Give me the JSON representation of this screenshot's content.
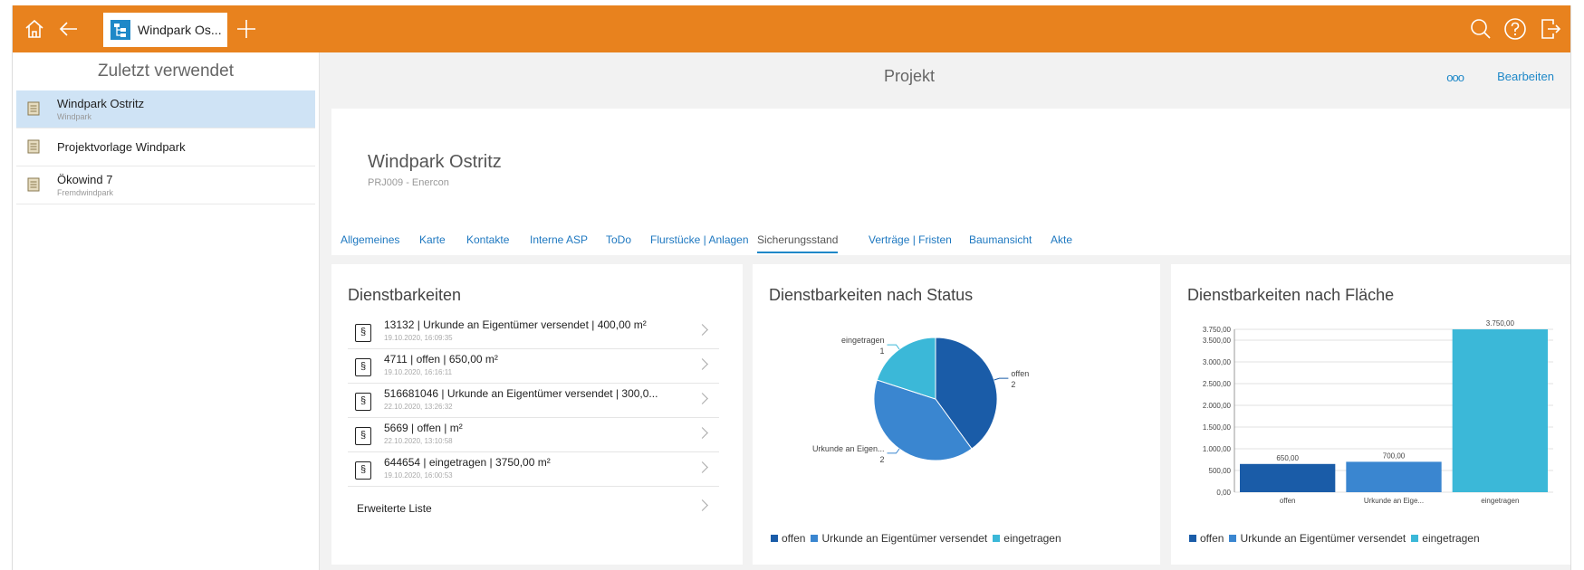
{
  "topbar": {
    "tab_label": "Windpark Os...",
    "icons": [
      "home-icon",
      "back-arrow-icon",
      "plus-icon",
      "search-icon",
      "help-icon",
      "logout-icon"
    ],
    "color": "#e8821e"
  },
  "sidebar": {
    "title": "Zuletzt verwendet",
    "items": [
      {
        "name": "Windpark Ostritz",
        "sub": "Windpark"
      },
      {
        "name": "Projektvorlage Windpark",
        "sub": ""
      },
      {
        "name": "Ökowind 7",
        "sub": "Fremdwindpark"
      }
    ]
  },
  "header": {
    "title": "Projekt",
    "dots": "ooo",
    "edit": "Bearbeiten"
  },
  "project": {
    "name": "Windpark Ostritz",
    "sub": "PRJ009 - Enercon",
    "tabs": [
      "Allgemeines",
      "Karte",
      "Kontakte",
      "Interne ASP",
      "ToDo",
      "Flurstücke | Anlagen",
      "Sicherungsstand",
      "Verträge | Fristen",
      "Baumansicht",
      "Akte"
    ],
    "active_tab": "Sicherungsstand"
  },
  "list_panel": {
    "title": "Dienstbarkeiten",
    "items": [
      {
        "title": "13132 | Urkunde an Eigentümer versendet | 400,00 m²",
        "date": "19.10.2020, 16:09:35"
      },
      {
        "title": "4711 | offen | 650,00 m²",
        "date": "19.10.2020, 16:16:11"
      },
      {
        "title": "516681046 | Urkunde an Eigentümer versendet | 300,0...",
        "date": "22.10.2020, 13:26:32"
      },
      {
        "title": "5669 | offen | m²",
        "date": "22.10.2020, 13:10:58"
      },
      {
        "title": "644654 | eingetragen | 3750,00 m²",
        "date": "19.10.2020, 16:00:53"
      }
    ],
    "more": "Erweiterte Liste",
    "doc_symbol": "§"
  },
  "colors": {
    "offen": "#1a5ca8",
    "urkunde": "#3a86d0",
    "eingetragen": "#3bb8d8"
  },
  "chart_data": [
    {
      "type": "pie",
      "title": "Dienstbarkeiten nach Status",
      "categories": [
        "offen",
        "Urkunde an Eigentümer versendet",
        "eingetragen"
      ],
      "labels": [
        "offen",
        "Urkunde an Eigen...",
        "eingetragen"
      ],
      "values": [
        2,
        2,
        1
      ],
      "legend": "bottom"
    },
    {
      "type": "bar",
      "title": "Dienstbarkeiten nach Fläche",
      "categories": [
        "offen",
        "Urkunde an Eige...",
        "eingetragen"
      ],
      "legend_entries": [
        "offen",
        "Urkunde an Eigentümer versendet",
        "eingetragen"
      ],
      "values": [
        650,
        700,
        3750
      ],
      "value_labels": [
        "650,00",
        "700,00",
        "3.750,00"
      ],
      "yticks": [
        "0,00",
        "500,00",
        "1.000,00",
        "1.500,00",
        "2.000,00",
        "2.500,00",
        "3.000,00",
        "3.500,00",
        "3.750,00"
      ],
      "ytick_values": [
        0,
        500,
        1000,
        1500,
        2000,
        2500,
        3000,
        3500,
        3750
      ],
      "ylim": [
        0,
        3750
      ],
      "grid": true,
      "legend": "bottom"
    }
  ]
}
